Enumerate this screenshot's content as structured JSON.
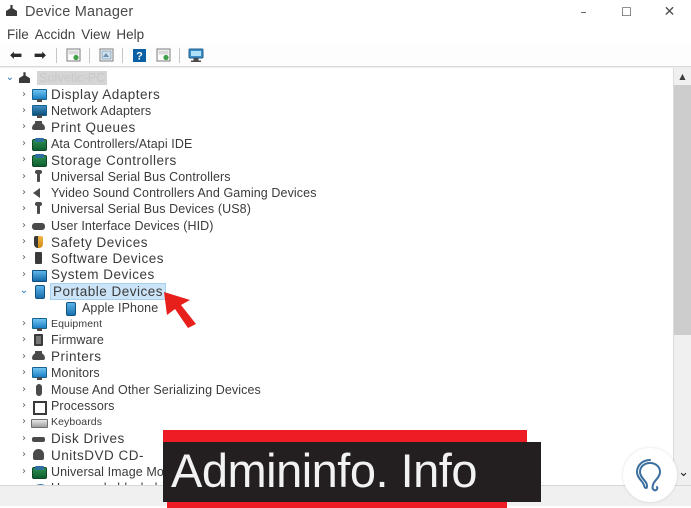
{
  "window": {
    "title": "Device Manager",
    "title_icon": "device-manager-icon",
    "controls": {
      "minimize": "–",
      "maximize": "☐",
      "close": "✕"
    }
  },
  "menubar": {
    "items": [
      {
        "label": "File"
      },
      {
        "label": "Accidn"
      },
      {
        "label": "View"
      },
      {
        "label": "Help"
      }
    ]
  },
  "toolbar": {
    "buttons": [
      {
        "name": "back-arrow-icon",
        "glyph": "⬅"
      },
      {
        "name": "forward-arrow-icon",
        "glyph": "➡"
      },
      {
        "name": "properties-icon",
        "glyph": ""
      },
      {
        "name": "scan-hardware-icon",
        "glyph": ""
      },
      {
        "name": "help-icon",
        "glyph": "?"
      },
      {
        "name": "update-driver-icon",
        "glyph": ""
      },
      {
        "name": "show-hidden-devices-icon",
        "glyph": ""
      }
    ]
  },
  "tree": {
    "root": {
      "label": "Solvetic-PC",
      "icon": "computer-icon"
    },
    "items": [
      {
        "label": "Display Adapters",
        "icon": "monitor-icon",
        "style": "big",
        "depth": 1,
        "expandable": true
      },
      {
        "label": "Network Adapters",
        "icon": "network-icon",
        "style": "normal",
        "depth": 1,
        "expandable": true
      },
      {
        "label": "Print Queues",
        "icon": "printer-icon",
        "style": "big",
        "depth": 1,
        "expandable": true
      },
      {
        "label": "Ata Controllers/Atapi IDE",
        "icon": "controller-icon",
        "style": "normal",
        "depth": 1,
        "expandable": true
      },
      {
        "label": "Storage Controllers",
        "icon": "storage-icon",
        "style": "big",
        "depth": 1,
        "expandable": true
      },
      {
        "label": "Universal Serial Bus Controllers",
        "icon": "usb-icon",
        "style": "normal",
        "depth": 1,
        "expandable": true
      },
      {
        "label": "Yvideo Sound Controllers And Gaming Devices",
        "icon": "speaker-icon",
        "style": "normal",
        "depth": 1,
        "expandable": true
      },
      {
        "label": "Universal Serial Bus Devices (US8)",
        "icon": "usb-icon",
        "style": "normal",
        "depth": 1,
        "expandable": true
      },
      {
        "label": "User Interface Devices (HID)",
        "icon": "hid-icon",
        "style": "normal",
        "depth": 1,
        "expandable": true
      },
      {
        "label": "Safety Devices",
        "icon": "shield-icon",
        "style": "big",
        "depth": 1,
        "expandable": true
      },
      {
        "label": "Software Devices",
        "icon": "chip-icon",
        "style": "big",
        "depth": 1,
        "expandable": true
      },
      {
        "label": "System Devices",
        "icon": "system-icon",
        "style": "big",
        "depth": 1,
        "expandable": true
      },
      {
        "label": "Portable Devices",
        "icon": "phone-icon",
        "style": "big",
        "depth": 1,
        "expandable": true,
        "expanded": true,
        "selected": true
      },
      {
        "label": "Apple IPhone",
        "icon": "phone-icon",
        "style": "normal",
        "depth": 2,
        "expandable": false
      },
      {
        "label": "Equipment",
        "icon": "monitor-icon",
        "style": "small",
        "depth": 1,
        "expandable": true
      },
      {
        "label": "Firmware",
        "icon": "firmware-icon",
        "style": "normal",
        "depth": 1,
        "expandable": true
      },
      {
        "label": "Printers",
        "icon": "printer-icon",
        "style": "big",
        "depth": 1,
        "expandable": true
      },
      {
        "label": "Monitors",
        "icon": "monitor-icon",
        "style": "normal",
        "depth": 1,
        "expandable": true
      },
      {
        "label": "Mouse And Other Serializing Devices",
        "icon": "mouse-icon",
        "style": "normal",
        "depth": 1,
        "expandable": true
      },
      {
        "label": "Processors",
        "icon": "cpu-icon",
        "style": "normal",
        "depth": 1,
        "expandable": true
      },
      {
        "label": "Keyboards",
        "icon": "keyboard-icon",
        "style": "small",
        "depth": 1,
        "expandable": true
      },
      {
        "label": "Disk Drives",
        "icon": "disk-icon",
        "style": "big",
        "depth": 1,
        "expandable": true
      },
      {
        "label": "UnitsDVD CD-",
        "icon": "dvd-icon",
        "style": "big",
        "depth": 1,
        "expandable": true
      },
      {
        "label": "Universal Image Mount",
        "icon": "controller-icon",
        "style": "normal",
        "depth": 1,
        "expandable": true
      },
      {
        "label": "User-mode block devic",
        "icon": "blockdev-icon",
        "style": "normal",
        "depth": 1,
        "expandable": true
      }
    ]
  },
  "scrollbar": {
    "up_arrow": "▲",
    "down_arrow": "▼"
  },
  "overlays": {
    "pointer_arrow": "red-pointer-arrow",
    "watermark_text": "Admininfo. Info",
    "watermark_red": "#ee1c24",
    "watermark_dark": "#231f20",
    "help_badge_icon": "lightbulb-icon",
    "chevron_icon": "⌄"
  }
}
